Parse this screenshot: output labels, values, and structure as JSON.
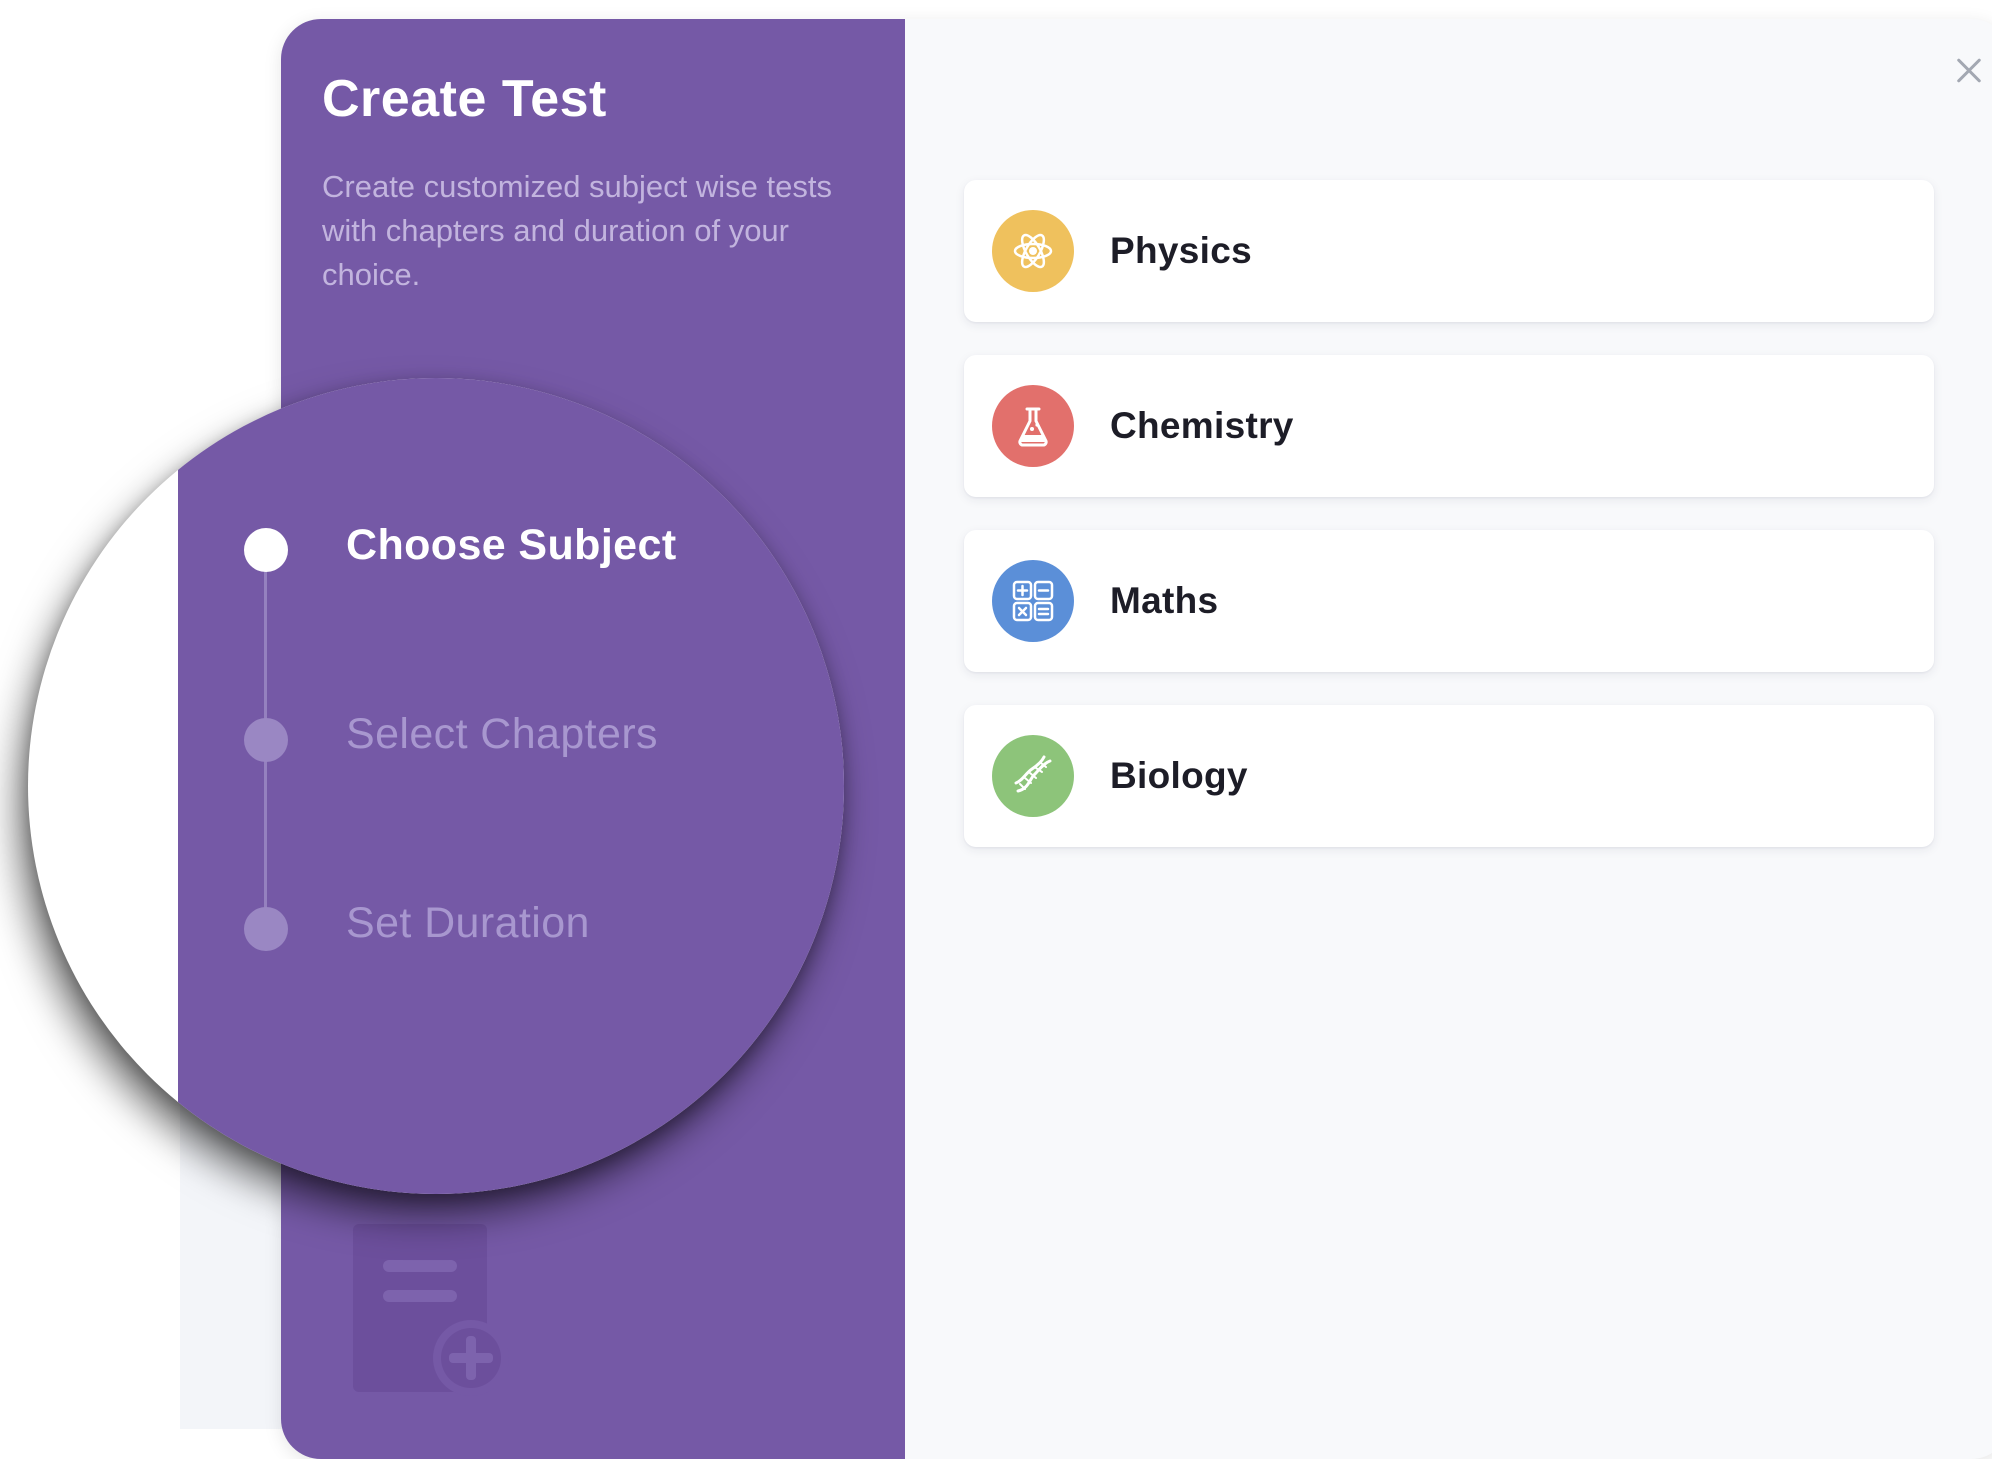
{
  "modal": {
    "title": "Create Test",
    "description": "Create customized subject wise tests with chapters and duration of your choice."
  },
  "steps": [
    {
      "label": "Choose Subject",
      "active": true
    },
    {
      "label": "Select Chapters",
      "active": false
    },
    {
      "label": "Set Duration",
      "active": false
    }
  ],
  "subjects": [
    {
      "label": "Physics",
      "icon": "atom-icon",
      "color": "#efc15d"
    },
    {
      "label": "Chemistry",
      "icon": "flask-icon",
      "color": "#e2706c"
    },
    {
      "label": "Maths",
      "icon": "calculator-icon",
      "color": "#5b8fd8"
    },
    {
      "label": "Biology",
      "icon": "dna-icon",
      "color": "#8dc47a"
    }
  ],
  "colors": {
    "panel": "#7559a6",
    "background": "#f8f9fb"
  }
}
